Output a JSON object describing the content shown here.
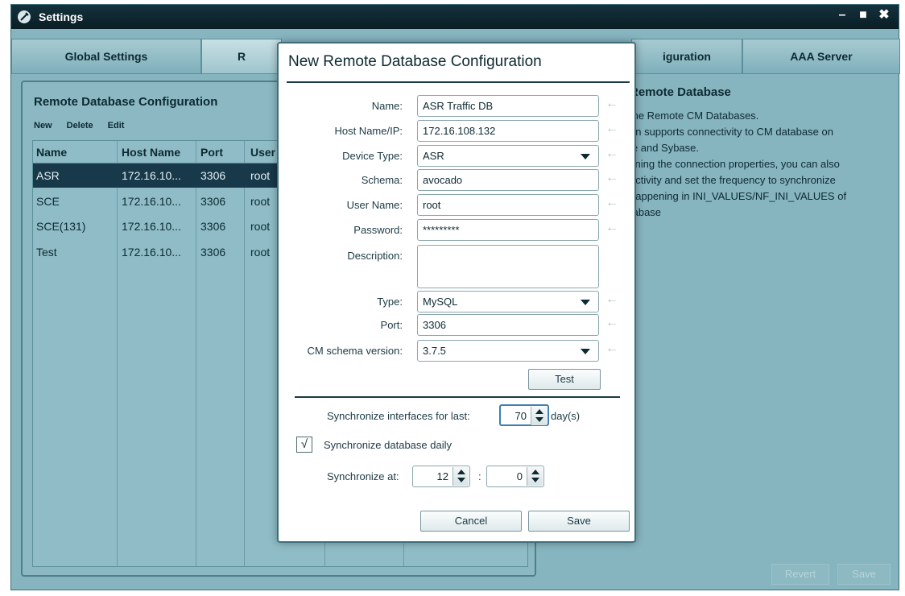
{
  "window": {
    "title": "Settings",
    "controls": [
      "–",
      "■",
      "✖"
    ]
  },
  "tabs": [
    {
      "label": "Global Settings"
    },
    {
      "label": "R"
    },
    {
      "label": "iguration"
    },
    {
      "label": "AAA Server"
    }
  ],
  "left_panel": {
    "title": "Remote Database Configuration",
    "toolbar": {
      "new": "New",
      "delete": "Delete",
      "edit": "Edit"
    },
    "columns": [
      "Name",
      "Host Name",
      "Port",
      "User"
    ],
    "rows": [
      {
        "name": "ASR",
        "host": "172.16.10...",
        "port": "3306",
        "user": "root",
        "selected": true
      },
      {
        "name": "SCE",
        "host": "172.16.10...",
        "port": "3306",
        "user": "root"
      },
      {
        "name": "SCE(131)",
        "host": "172.16.10...",
        "port": "3306",
        "user": "root"
      },
      {
        "name": "Test",
        "host": "172.16.10...",
        "port": "3306",
        "user": "root"
      }
    ]
  },
  "right_panel": {
    "title": "Remote Database",
    "lines": [
      "the Remote CM Databases.",
      "on supports connectivity to CM database on",
      "le and Sybase.",
      "fining the connection properties, you can also",
      "ectivity and set the frequency to synchronize",
      "happening in INI_VALUES/NF_INI_VALUES of",
      "tabase"
    ],
    "revert_label": "Revert",
    "save_label": "Save"
  },
  "dialog": {
    "title": "New Remote Database Configuration",
    "fields": {
      "name_label": "Name:",
      "name_value": "ASR Traffic DB",
      "host_label": "Host Name/IP:",
      "host_value": "172.16.108.132",
      "device_label": "Device Type:",
      "device_value": "ASR",
      "schema_label": "Schema:",
      "schema_value": "avocado",
      "user_label": "User Name:",
      "user_value": "root",
      "password_label": "Password:",
      "password_value": "*********",
      "description_label": "Description:",
      "type_label": "Type:",
      "type_value": "MySQL",
      "port_label": "Port:",
      "port_value": "3306",
      "cm_label": "CM schema version:",
      "cm_value": "3.7.5"
    },
    "test_label": "Test",
    "sync_interfaces_label": "Synchronize interfaces for last:",
    "sync_days_value": "70",
    "days_unit": "day(s)",
    "sync_daily_label": "Synchronize database daily",
    "sync_daily_checked": "√",
    "sync_at_label": "Synchronize at:",
    "sync_hour": "12",
    "sync_colon": ":",
    "sync_minute": "0",
    "cancel_label": "Cancel",
    "save_label": "Save",
    "arrow_glyph": "←"
  },
  "colors": {
    "window_bg": "#86b4bf",
    "titlebar": "#0a1d24",
    "selected_row": "#17394a",
    "dialog_bg": "#ffffff"
  }
}
